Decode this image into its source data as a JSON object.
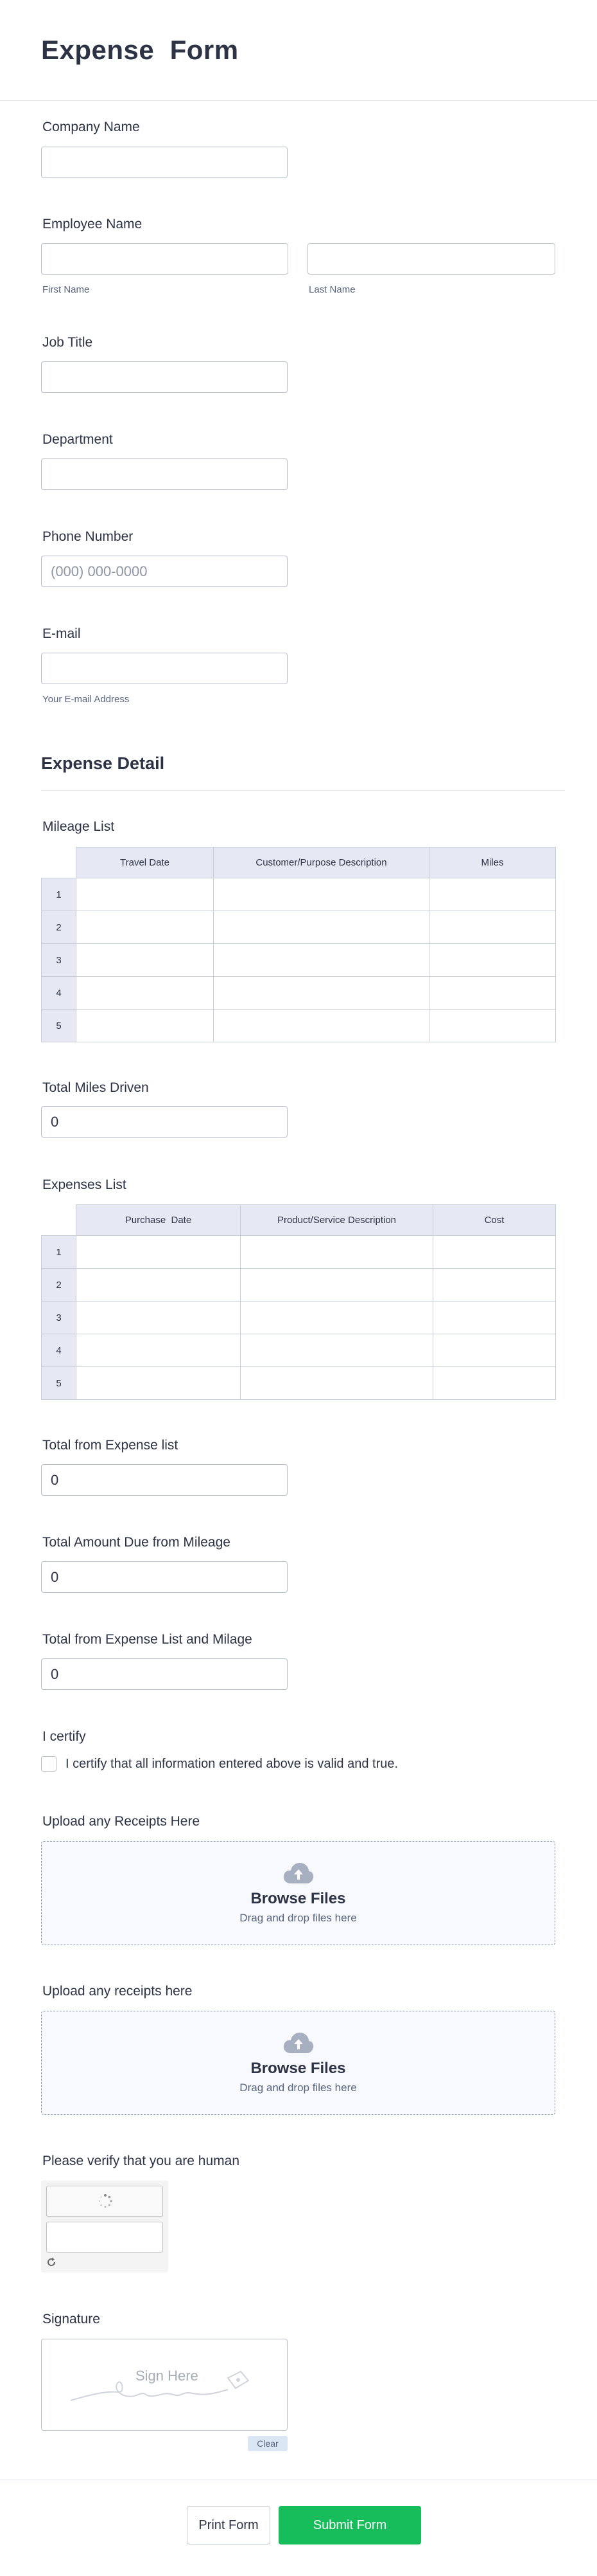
{
  "form": {
    "title": "Expense  Form"
  },
  "company": {
    "label": "Company Name",
    "value": ""
  },
  "employee": {
    "label": "Employee Name",
    "first_sublabel": "First Name",
    "last_sublabel": "Last Name",
    "first_value": "",
    "last_value": ""
  },
  "job_title": {
    "label": "Job Title",
    "value": ""
  },
  "department": {
    "label": "Department",
    "value": ""
  },
  "phone": {
    "label": "Phone Number",
    "placeholder": "(000) 000-0000"
  },
  "email": {
    "label": "E-mail",
    "sublabel": "Your E-mail Address",
    "value": ""
  },
  "expense_detail": {
    "heading": "Expense Detail"
  },
  "mileage": {
    "label": "Mileage List",
    "columns": [
      "Travel Date",
      "Customer/Purpose Description",
      "Miles"
    ],
    "rows": [
      "1",
      "2",
      "3",
      "4",
      "5"
    ]
  },
  "total_miles": {
    "label": "Total Miles Driven",
    "value": "0"
  },
  "expenses": {
    "label": "Expenses List",
    "columns": [
      "Purchase  Date",
      "Product/Service Description",
      "Cost"
    ],
    "rows": [
      "1",
      "2",
      "3",
      "4",
      "5"
    ]
  },
  "total_expense": {
    "label": "Total from Expense list",
    "value": "0"
  },
  "total_mileage_due": {
    "label": "Total Amount Due from Mileage",
    "value": "0"
  },
  "total_combined": {
    "label": "Total from Expense List and Milage",
    "value": "0"
  },
  "certify": {
    "label": "I certify",
    "text": "I certify that all information entered above is valid and true."
  },
  "upload1": {
    "label": "Upload any Receipts Here",
    "browse": "Browse Files",
    "drag": "Drag and drop files here",
    "icon": "cloud-upload-icon"
  },
  "upload2": {
    "label": "Upload any receipts here",
    "browse": "Browse Files",
    "drag": "Drag and drop files here",
    "icon": "cloud-upload-icon"
  },
  "captcha": {
    "label": "Please verify that you are human"
  },
  "signature": {
    "label": "Signature",
    "placeholder": "Sign Here",
    "clear": "Clear"
  },
  "actions": {
    "print": "Print Form",
    "submit": "Submit Form"
  },
  "colors": {
    "accent": "#18bd5b",
    "text": "#2c3345",
    "header_fill": "#e6e9f3"
  }
}
